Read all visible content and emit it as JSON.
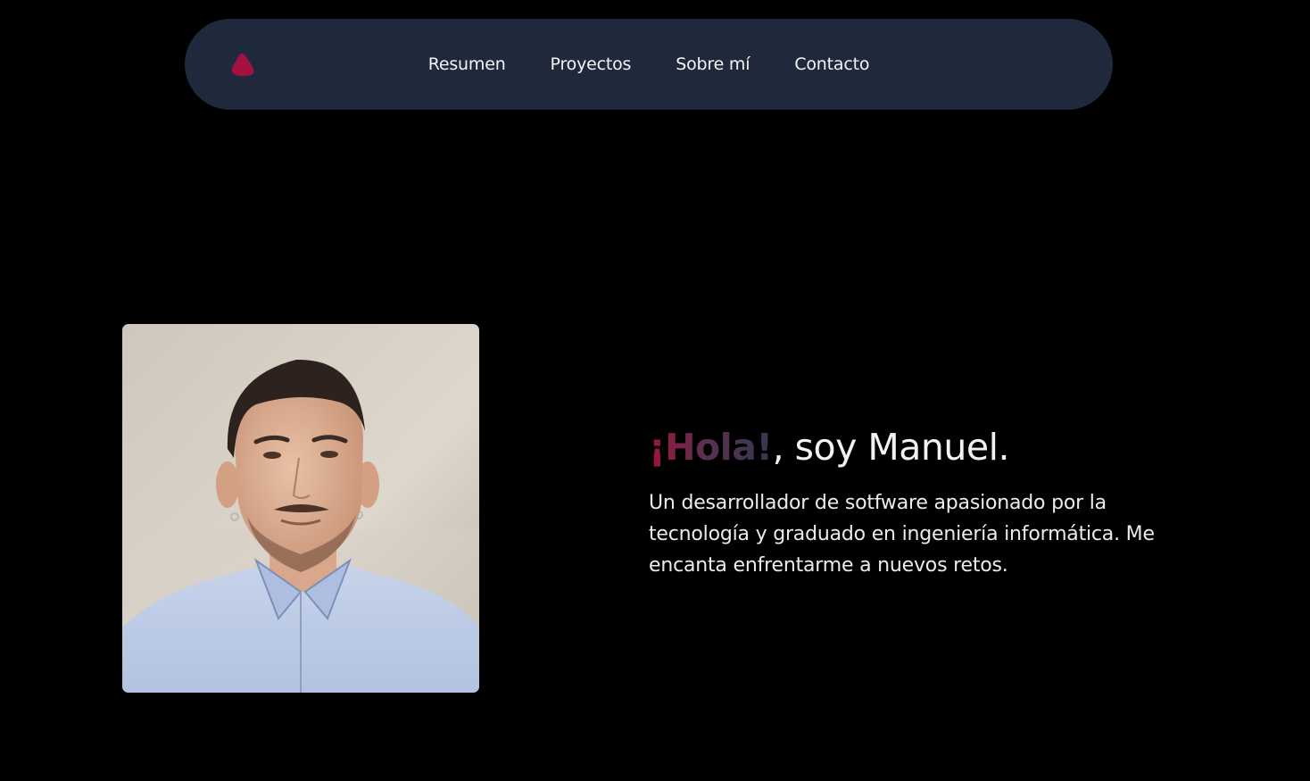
{
  "nav": {
    "logo_icon": "drop-logo-icon",
    "links": [
      {
        "label": "Resumen"
      },
      {
        "label": "Proyectos"
      },
      {
        "label": "Sobre mí"
      },
      {
        "label": "Contacto"
      }
    ]
  },
  "hero": {
    "greeting_highlight": "¡Hola!",
    "greeting_rest": ", soy Manuel.",
    "intro": "Un desarrollador de sotfware apasionado por la tecnología y graduado en ingeniería informática. Me encanta enfrentarme a nuevos retos.",
    "photo_icon": "profile-photo"
  },
  "colors": {
    "background": "#000000",
    "navbar": "#1f293b",
    "accent": "#a1123f",
    "accent_dark": "#34384f",
    "text": "#f2f2f4"
  }
}
